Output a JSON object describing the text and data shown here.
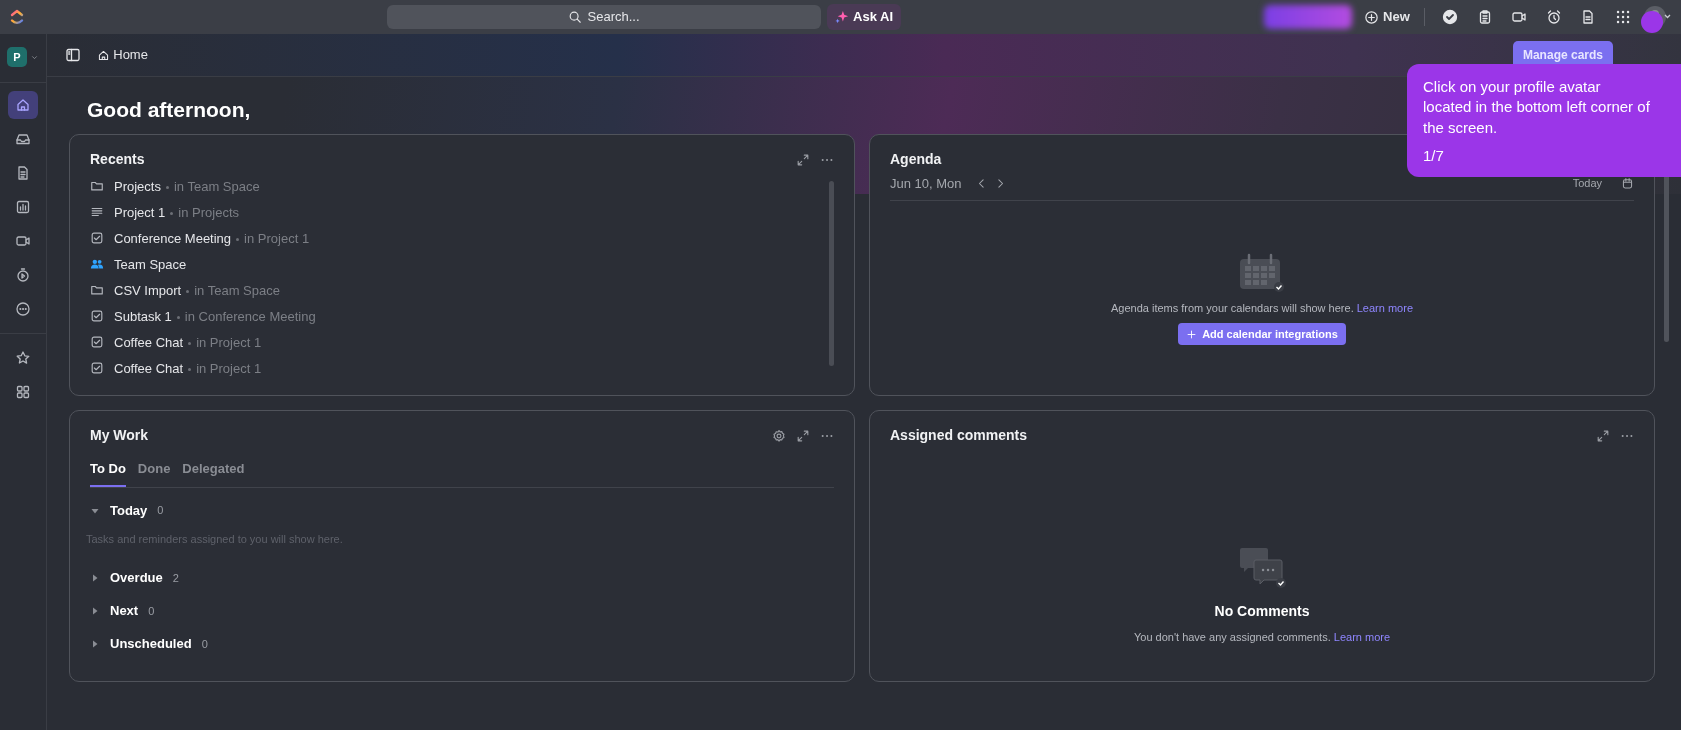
{
  "topbar": {
    "search_placeholder": "Search...",
    "ask_ai": "Ask AI",
    "new_button": "New"
  },
  "sidebar": {
    "items": [
      {
        "kind": "home",
        "selected": true
      },
      {
        "kind": "inbox",
        "selected": false
      },
      {
        "kind": "docs",
        "selected": false
      },
      {
        "kind": "dashboards",
        "selected": false
      },
      {
        "kind": "clips",
        "selected": false
      },
      {
        "kind": "timesheets",
        "selected": false
      },
      {
        "kind": "more",
        "selected": false
      },
      {
        "kind": "favorites",
        "selected": false
      },
      {
        "kind": "spaces",
        "selected": false
      }
    ]
  },
  "workspace": {
    "initial": "P"
  },
  "breadcrumb": {
    "page": "Home"
  },
  "manage_cards": "Manage cards",
  "greeting": "Good afternoon,",
  "recents": {
    "title": "Recents",
    "items": [
      {
        "kind": "folder",
        "name": "Projects",
        "location": "in Team Space"
      },
      {
        "kind": "list",
        "name": "Project 1",
        "location": "in Projects"
      },
      {
        "kind": "task",
        "name": "Conference Meeting",
        "location": "in Project 1"
      },
      {
        "kind": "space",
        "name": "Team Space"
      },
      {
        "kind": "folder",
        "name": "CSV Import",
        "location": "in Team Space"
      },
      {
        "kind": "task",
        "name": "Subtask 1",
        "location": "in Conference Meeting"
      },
      {
        "kind": "task",
        "name": "Coffee Chat",
        "location": "in Project 1"
      },
      {
        "kind": "task",
        "name": "Coffee Chat",
        "location": "in Project 1"
      }
    ]
  },
  "agenda": {
    "title": "Agenda",
    "date": "Jun 10, Mon",
    "today": "Today",
    "empty_text": "Agenda items from your calendars will show here.",
    "link": "Learn more",
    "button": "Add calendar integrations"
  },
  "my_work": {
    "title": "My Work",
    "tabs": [
      {
        "label": "To Do",
        "selected": true
      },
      {
        "label": "Done",
        "selected": false
      },
      {
        "label": "Delegated",
        "selected": false
      }
    ],
    "groups": [
      {
        "label": "Today",
        "count": "0",
        "expanded": true,
        "hint": "Tasks and reminders assigned to you will show here."
      },
      {
        "label": "Overdue",
        "count": "2",
        "expanded": false
      },
      {
        "label": "Next",
        "count": "0",
        "expanded": false
      },
      {
        "label": "Unscheduled",
        "count": "0",
        "expanded": false
      }
    ]
  },
  "assigned_comments": {
    "title": "Assigned comments",
    "empty_title": "No Comments",
    "empty_text": "You don't have any assigned comments.",
    "link": "Learn more"
  },
  "tour_tooltip": {
    "text": "Click on your profile avatar located in the bottom left corner of the screen.",
    "step": "1/7"
  }
}
